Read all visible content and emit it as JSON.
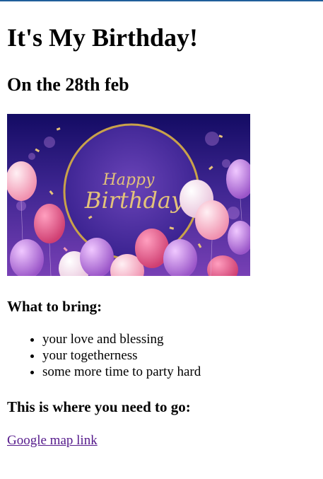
{
  "page": {
    "title": "It's My Birthday!",
    "subtitle": "On the 28th feb"
  },
  "banner": {
    "image_alt": "Happy Birthday balloons banner",
    "text_line1": "Happy",
    "text_line2": "Birthday",
    "colors": {
      "background_top": "#1a1170",
      "background_mid": "#4b2a9a",
      "background_bottom": "#7a3fb8",
      "ring_gold": "#c9a24a",
      "balloon_pink": "#e8608c",
      "balloon_light_pink": "#f6b8c8",
      "balloon_purple": "#b67ad6",
      "balloon_white": "#f4e6f0"
    }
  },
  "bring_section": {
    "heading": "What to bring:",
    "items": [
      "your love and blessing",
      "your togetherness",
      "some more time to party hard"
    ]
  },
  "go_section": {
    "heading": "This is where you need to go:",
    "link_text": "Google map link",
    "link_color": "#551a8b"
  }
}
